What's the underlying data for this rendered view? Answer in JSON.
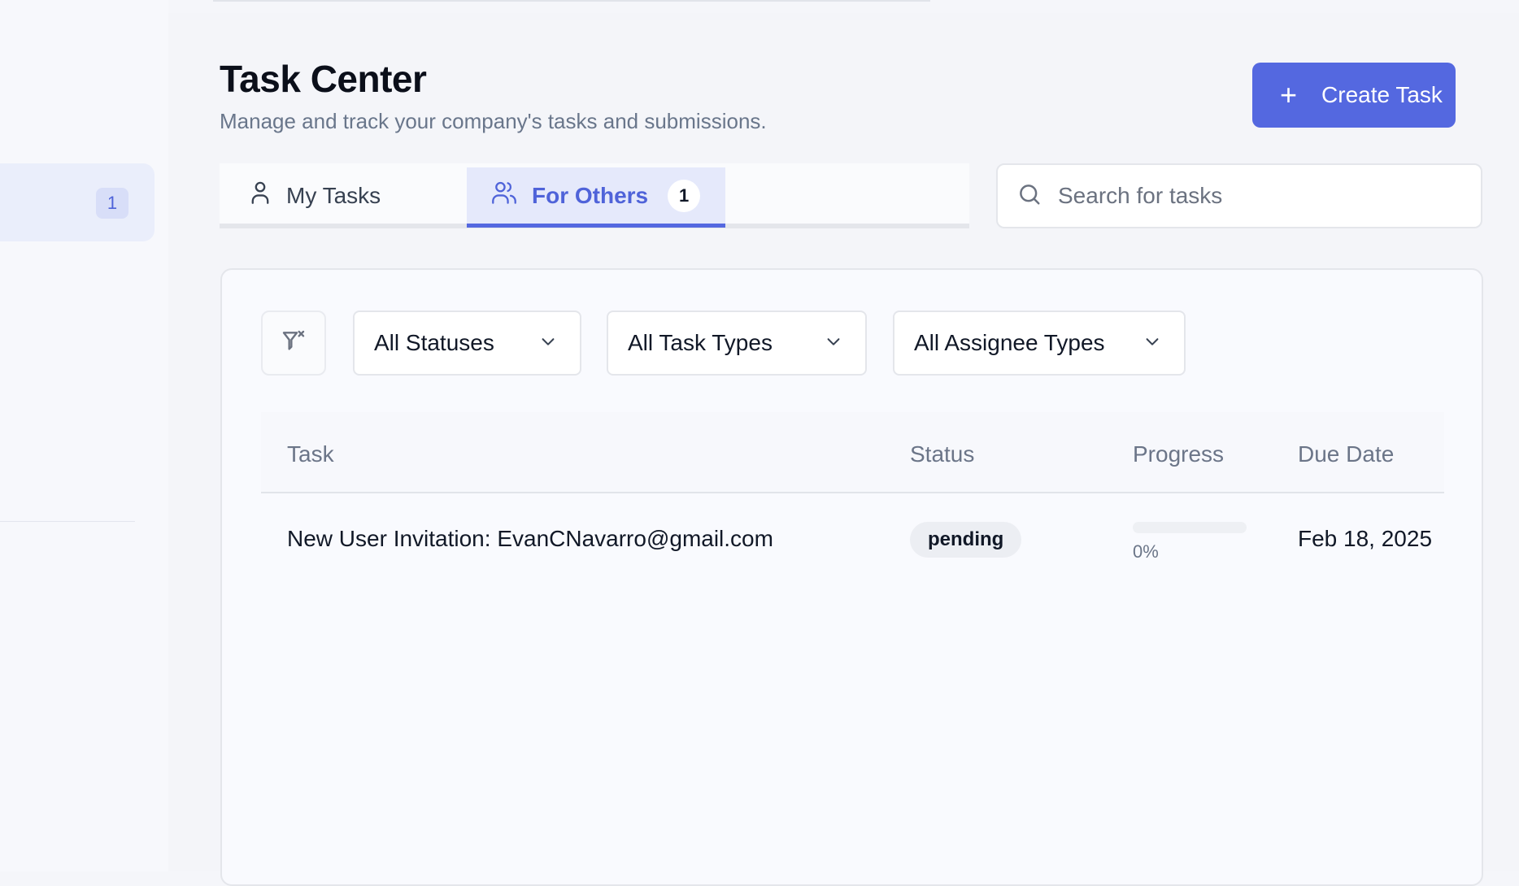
{
  "sidebar": {
    "active_item_badge": "1"
  },
  "header": {
    "title": "Task Center",
    "subtitle": "Manage and track your company's tasks and submissions.",
    "create_button_label": "Create Task"
  },
  "tabs": [
    {
      "label": "My Tasks",
      "icon": "user-icon",
      "active": false
    },
    {
      "label": "For Others",
      "icon": "users-icon",
      "active": true,
      "count": "1"
    }
  ],
  "search": {
    "placeholder": "Search for tasks",
    "value": ""
  },
  "filters": {
    "status": "All Statuses",
    "task_type": "All Task Types",
    "assignee_type": "All Assignee Types"
  },
  "table": {
    "columns": [
      "Task",
      "Status",
      "Progress",
      "Due Date"
    ],
    "rows": [
      {
        "task": "New User Invitation: EvanCNavarro@gmail.com",
        "status": "pending",
        "progress": 0,
        "progress_label": "0%",
        "due_date": "Feb 18, 2025"
      }
    ]
  },
  "colors": {
    "accent": "#5468e0",
    "accent_light": "#e5e9fb"
  }
}
